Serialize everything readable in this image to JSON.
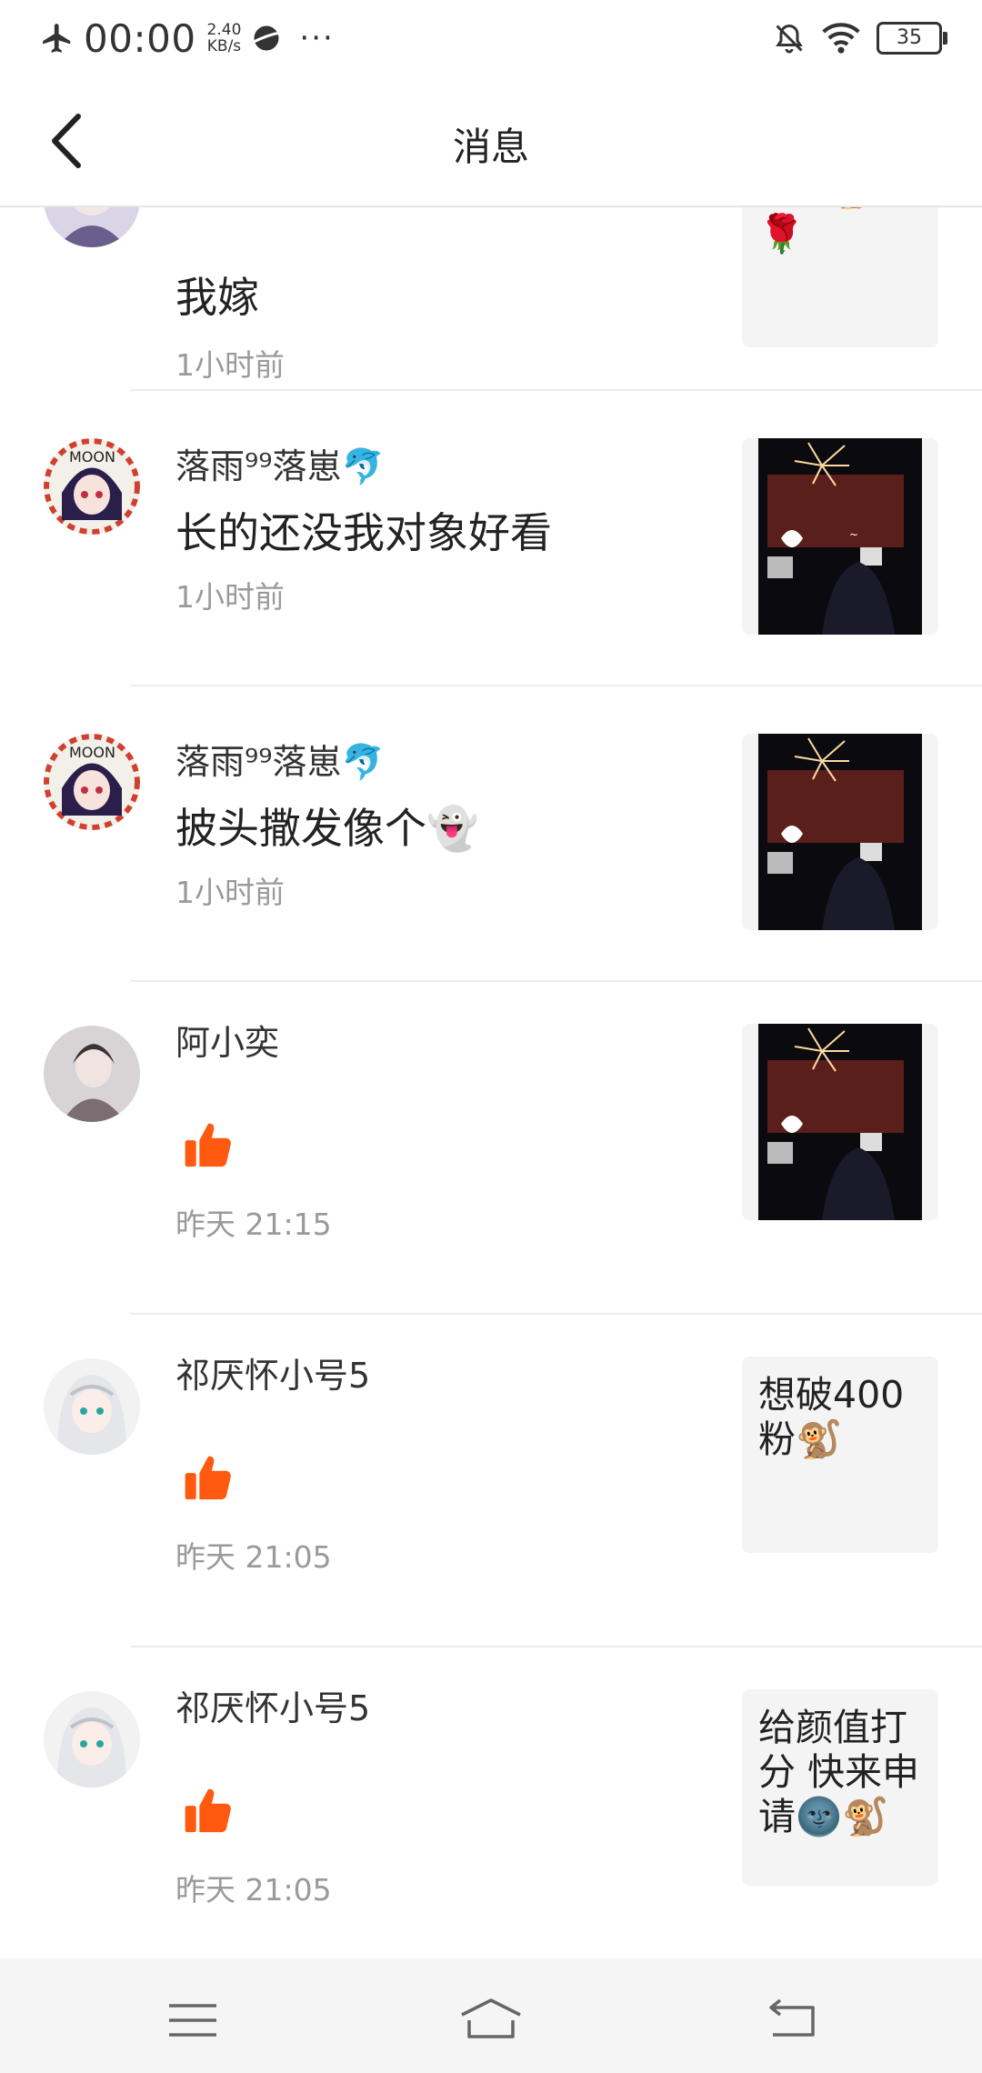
{
  "status_bar": {
    "time": "00:00",
    "speed_value": "2.40",
    "speed_unit": "KB/s",
    "more": "···",
    "battery": "35",
    "airplane_icon": "airplane-icon",
    "mute_icon": "bell-off-icon",
    "wifi_icon": "wifi-icon"
  },
  "header": {
    "title": "消息",
    "back_icon": "chevron-left-icon"
  },
  "messages": [
    {
      "name": "",
      "text": "我嫁",
      "time": "1小时前",
      "preview_text": "给我🐒\n🌹",
      "avatar": "avatar-purple-girl"
    },
    {
      "name": "落雨⁹⁹落崽🐬",
      "text": "长的还没我对象好看",
      "time": "1小时前",
      "preview": "photo-fireworks",
      "avatar": "avatar-moon-girl"
    },
    {
      "name": "落雨⁹⁹落崽🐬",
      "text": "披头撒发像个👻",
      "time": "1小时前",
      "preview": "photo-fireworks",
      "avatar": "avatar-moon-girl"
    },
    {
      "name": "阿小奕",
      "like": "thumbs-up-icon",
      "time": "昨天 21:15",
      "preview": "photo-fireworks",
      "avatar": "avatar-boy-scarf"
    },
    {
      "name": "祁厌怀小号5",
      "like": "thumbs-up-icon",
      "time": "昨天 21:05",
      "preview_text": "想破400粉🐒",
      "avatar": "avatar-white-hair-girl"
    },
    {
      "name": "祁厌怀小号5",
      "like": "thumbs-up-icon",
      "time": "昨天 21:05",
      "preview_text": "给颜值打分 快来申请🌚🐒",
      "avatar": "avatar-white-hair-girl"
    }
  ],
  "colors": {
    "like_orange": "#ff5a0f",
    "time_gray": "#9a9a9a",
    "divider": "#ececec",
    "thumb_bg": "#f4f4f4"
  },
  "nav_bar": {
    "menu_icon": "menu-icon",
    "home_icon": "home-icon",
    "back_icon": "back-icon"
  }
}
